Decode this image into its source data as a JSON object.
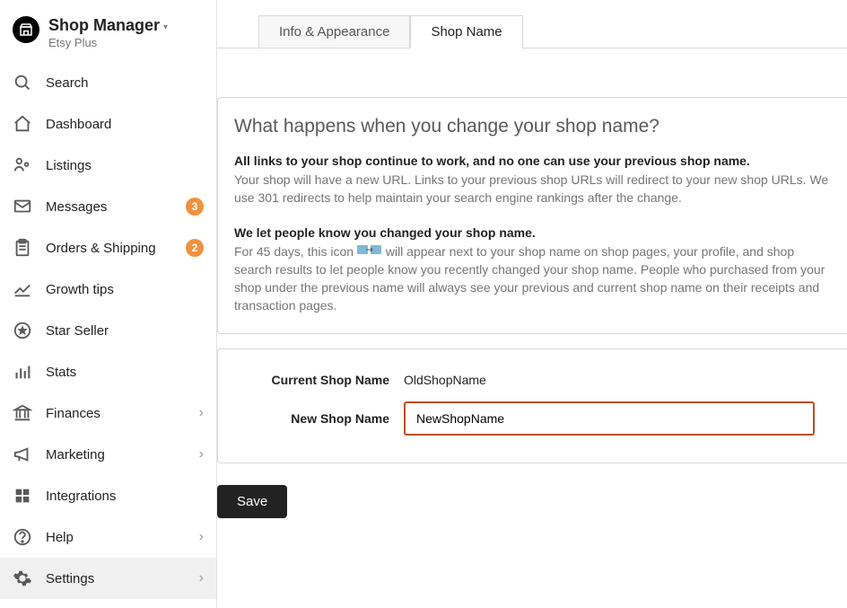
{
  "header": {
    "title": "Shop Manager",
    "plan": "Etsy Plus"
  },
  "sidebar": {
    "items": [
      {
        "label": "Search"
      },
      {
        "label": "Dashboard"
      },
      {
        "label": "Listings"
      },
      {
        "label": "Messages",
        "badge": "3"
      },
      {
        "label": "Orders & Shipping",
        "badge": "2"
      },
      {
        "label": "Growth tips"
      },
      {
        "label": "Star Seller"
      },
      {
        "label": "Stats"
      },
      {
        "label": "Finances",
        "chevron": true
      },
      {
        "label": "Marketing",
        "chevron": true
      },
      {
        "label": "Integrations"
      },
      {
        "label": "Help",
        "chevron": true
      },
      {
        "label": "Settings",
        "chevron": true
      }
    ]
  },
  "tabs": {
    "info": "Info & Appearance",
    "shopname": "Shop Name"
  },
  "info_card": {
    "title": "What happens when you change your shop name?",
    "line1_bold": "All links to your shop continue to work, and no one can use your previous shop name.",
    "line1_text": "Your shop will have a new URL. Links to your previous shop URLs will redirect to your new shop URLs. We use 301 redirects to help maintain your search engine rankings after the change.",
    "line2_bold": "We let people know you changed your shop name.",
    "line2_text_a": "For 45 days, this icon ",
    "line2_text_b": " will appear next to your shop name on shop pages, your profile, and shop search results to let people know you recently changed your shop name. People who purchased from your shop under the previous name will always see your previous and current shop name on their receipts and transaction pages."
  },
  "form": {
    "current_label": "Current Shop Name",
    "current_value": "OldShopName",
    "new_label": "New Shop Name",
    "new_value": "NewShopName"
  },
  "buttons": {
    "save": "Save"
  }
}
